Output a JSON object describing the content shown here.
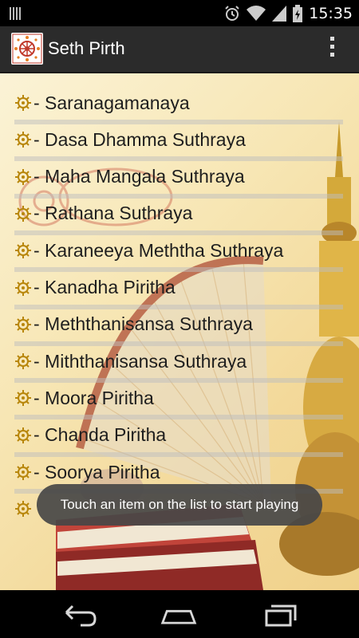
{
  "status_bar": {
    "time": "15:35",
    "icons": [
      "alarm-icon",
      "wifi-icon",
      "signal-icon",
      "battery-charging-icon"
    ]
  },
  "action_bar": {
    "title": "Seth Pirth",
    "icon": "dharma-wheel-logo",
    "menu_icon": "overflow-menu-icon"
  },
  "list": {
    "bullet_icon": "dharma-wheel-icon",
    "items": [
      "- Saranagamanaya",
      "- Dasa Dhamma Suthraya",
      "- Maha Mangala Suthraya",
      "- Rathana Suthraya",
      "- Karaneeya Meththa Suthraya",
      "- Kanadha Piritha",
      "- Meththanisansa Suthraya",
      "- Miththanisansa Suthraya",
      "- Moora Piritha",
      "- Chanda Piritha",
      "- Soorya Piritha"
    ]
  },
  "toast": {
    "message": "Touch an item on the list to start playing"
  },
  "nav_bar": {
    "buttons": [
      "back-icon",
      "home-icon",
      "recent-apps-icon"
    ]
  },
  "colors": {
    "status_bar": "#000000",
    "action_bar": "#2b2b2b",
    "list_text": "#1e1e1e",
    "bullet_gold": "#b8860b",
    "toast_bg": "#464646"
  }
}
